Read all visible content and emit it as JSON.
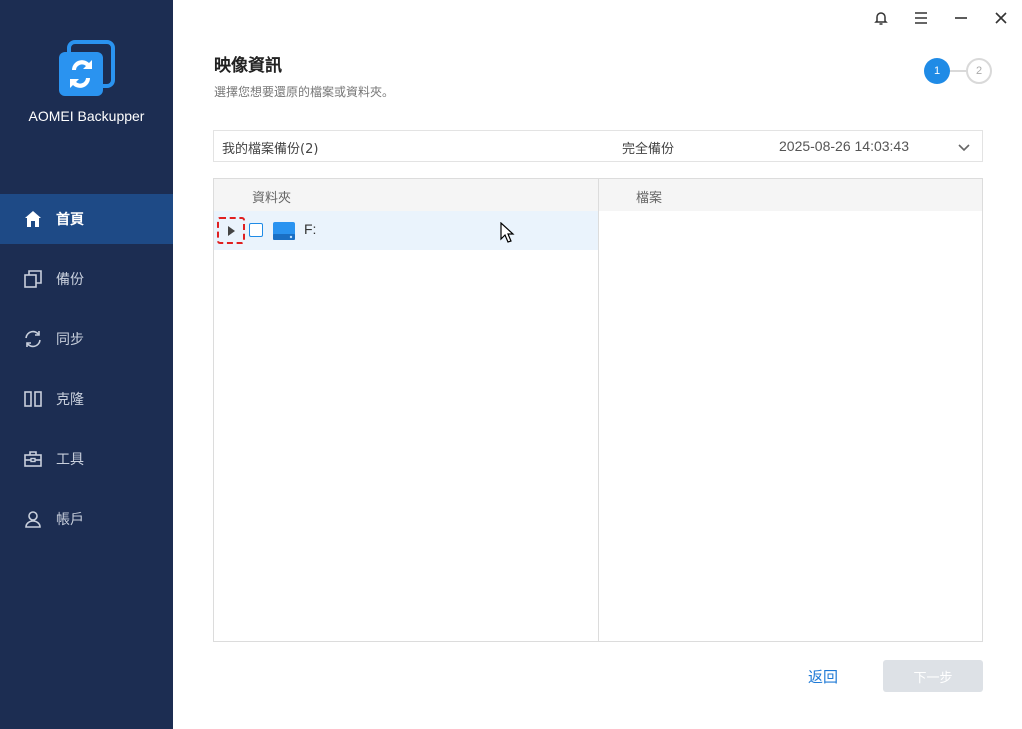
{
  "app": {
    "name": "AOMEI Backupper"
  },
  "sidebar": {
    "items": [
      {
        "label": "首頁",
        "icon": "home-icon",
        "active": true
      },
      {
        "label": "備份",
        "icon": "backup-icon",
        "active": false
      },
      {
        "label": "同步",
        "icon": "sync-icon",
        "active": false
      },
      {
        "label": "克隆",
        "icon": "clone-icon",
        "active": false
      },
      {
        "label": "工具",
        "icon": "tools-icon",
        "active": false
      },
      {
        "label": "帳戶",
        "icon": "account-icon",
        "active": false
      }
    ]
  },
  "titlebar": {
    "icons": [
      "bell-icon",
      "menu-icon",
      "minimize-icon",
      "close-icon"
    ]
  },
  "header": {
    "title": "映像資訊",
    "subtitle": "選擇您想要還原的檔案或資料夾。",
    "steps": [
      "1",
      "2"
    ],
    "current_step": 1
  },
  "backup": {
    "name": "我的檔案備份(2)",
    "type": "完全備份",
    "time": "2025-08-26 14:03:43"
  },
  "browser": {
    "folders_header": "資料夾",
    "files_header": "檔案",
    "tree": [
      {
        "label": "F:",
        "icon": "drive-icon",
        "checked": false,
        "expanded": false
      }
    ]
  },
  "footer": {
    "back_label": "返回",
    "next_label": "下一步"
  },
  "colors": {
    "sidebar_bg": "#1c2d52",
    "sidebar_active": "#1e4a86",
    "accent": "#1f8be6",
    "link": "#1f7ad6"
  }
}
